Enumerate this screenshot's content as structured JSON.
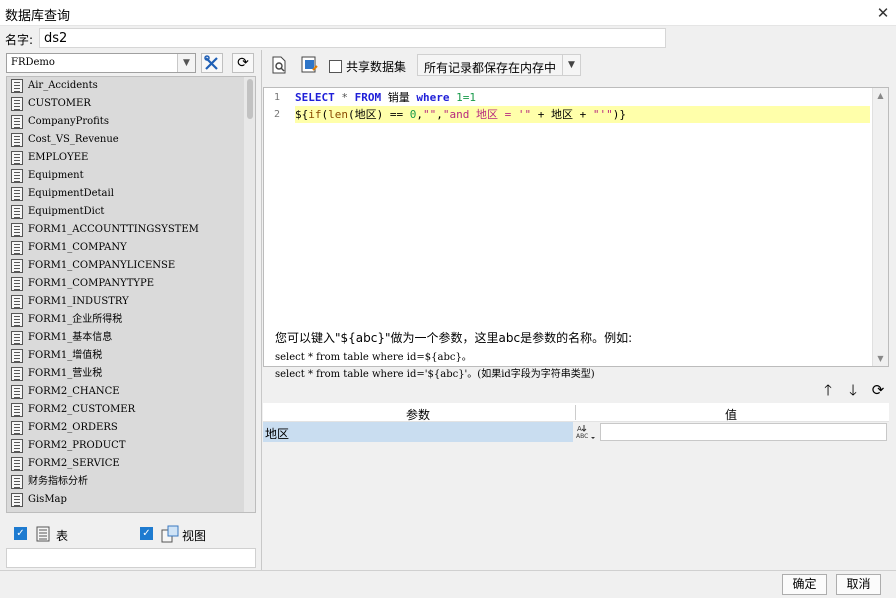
{
  "window": {
    "title": "数据库查询",
    "close_glyph": "✕"
  },
  "name_field": {
    "label": "名字:",
    "value": "ds2"
  },
  "left": {
    "datasource": "FRDemo",
    "tables": [
      "Air_Accidents",
      "CUSTOMER",
      "CompanyProfits",
      "Cost_VS_Revenue",
      "EMPLOYEE",
      "Equipment",
      "EquipmentDetail",
      "EquipmentDict",
      "FORM1_ACCOUNTTINGSYSTEM",
      "FORM1_COMPANY",
      "FORM1_COMPANYLICENSE",
      "FORM1_COMPANYTYPE",
      "FORM1_INDUSTRY",
      "FORM1_企业所得税",
      "FORM1_基本信息",
      "FORM1_增值税",
      "FORM1_营业税",
      "FORM2_CHANCE",
      "FORM2_CUSTOMER",
      "FORM2_ORDERS",
      "FORM2_PRODUCT",
      "FORM2_SERVICE",
      "财务指标分析",
      "GisMap"
    ],
    "check_table_label": "表",
    "check_view_label": "视图"
  },
  "toolbar": {
    "shared_dataset_label": "共享数据集",
    "memory_option": "所有记录都保存在内存中"
  },
  "editor": {
    "line_numbers": [
      "1",
      "2"
    ],
    "line1": {
      "select": "SELECT",
      "star": "*",
      "from": "FROM",
      "table": "销量",
      "where": "where",
      "cond": "1=1"
    },
    "line2": {
      "p1": "${",
      "fn_if": "if",
      "p2": "(",
      "fn_len": "len",
      "p3": "(地区) == ",
      "zero": "0",
      "p4": ",",
      "str1": "\"\"",
      "p5": ",",
      "str2": "\"and 地区 = '\"",
      "p6": " + 地区 + ",
      "str3": "\"'\"",
      "p7": ")}"
    }
  },
  "hint": {
    "line1": "您可以键入\"${abc}\"做为一个参数，这里abc是参数的名称。例如:",
    "line2": "select * from table where id=${abc}。",
    "line3": "select * from table where id='${abc}'。(如果id字段为字符串类型)"
  },
  "params": {
    "col_name": "参数",
    "col_value": "值",
    "rows": [
      {
        "name": "地区",
        "type_icon_text": "ABC",
        "value": ""
      }
    ]
  },
  "footer": {
    "ok": "确定",
    "cancel": "取消"
  }
}
